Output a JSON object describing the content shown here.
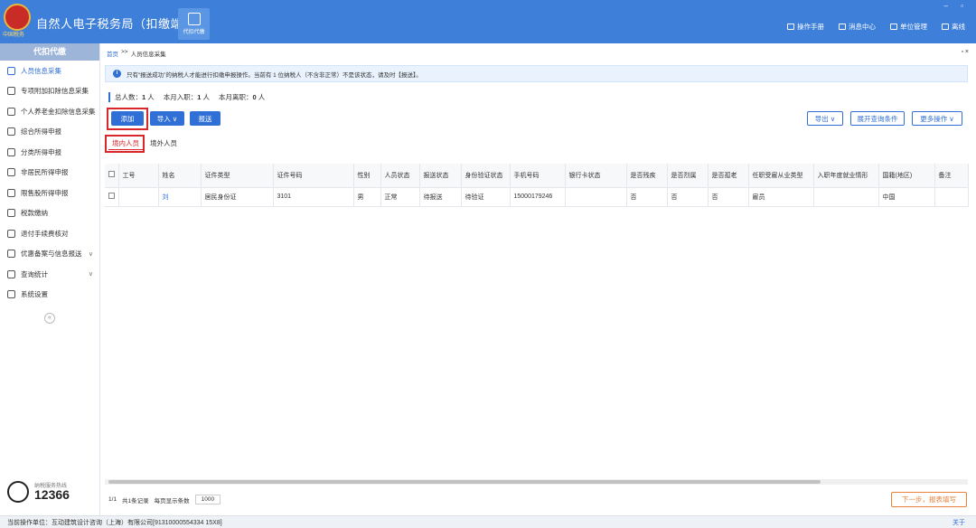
{
  "app": {
    "title": "自然人电子税务局（扣缴端）",
    "emblem_text": "中国税务"
  },
  "top_tab": {
    "label": "代扣代缴"
  },
  "top_actions": [
    "操作手册",
    "消息中心",
    "单位管理",
    "离线"
  ],
  "window_controls": "– ▫",
  "sidebar": {
    "header": "代扣代缴",
    "items": [
      {
        "label": "人员信息采集",
        "active": true
      },
      {
        "label": "专项附加扣除信息采集"
      },
      {
        "label": "个人养老金扣除信息采集"
      },
      {
        "label": "综合所得申报"
      },
      {
        "label": "分类所得申报"
      },
      {
        "label": "非居民所得申报"
      },
      {
        "label": "限售股所得申报"
      },
      {
        "label": "税款缴纳"
      },
      {
        "label": "退付手续费核对"
      },
      {
        "label": "优惠备案与信息报送",
        "chevron": "∨"
      },
      {
        "label": "查询统计",
        "chevron": "∨"
      },
      {
        "label": "系统设置"
      }
    ],
    "collapse": "«",
    "hotline_label": "纳税服务热线",
    "hotline_number": "12366"
  },
  "breadcrumb": {
    "home": "首页",
    "sep": ">>",
    "current": "人员信息采集",
    "close": "▫ ×"
  },
  "notice": {
    "icon": "i",
    "text": "只有“报送成功”的纳税人才能进行扣缴申报操作。当前有 1 位纳税人（不含非正常）不是该状态，请及时【报送】。"
  },
  "stats": {
    "total_label": "总人数：",
    "total": "1",
    "join_label": "本月入职：",
    "join": "1",
    "leave_label": "本月离职：",
    "leave": "0",
    "unit": "人"
  },
  "toolbar": {
    "add": "添加",
    "import": "导入 ∨",
    "submit": "报送",
    "export": "导出 ∨",
    "expand_query": "展开查询条件",
    "more": "更多操作 ∨"
  },
  "tabs": {
    "domestic": "境内人员",
    "overseas": "境外人员"
  },
  "table": {
    "columns": [
      "",
      "工号",
      "姓名",
      "证件类型",
      "证件号码",
      "性别",
      "人员状态",
      "报送状态",
      "身份验证状态",
      "手机号码",
      "银行卡状态",
      "是否残疾",
      "是否烈属",
      "是否孤老",
      "任职受雇从业类型",
      "入职年度就业情形",
      "国籍(地区)",
      "备注"
    ],
    "rows": [
      [
        "",
        "",
        "刘",
        "居民身份证",
        "3101",
        "男",
        "正常",
        "待报送",
        "待验证",
        "15000179246",
        "",
        "否",
        "否",
        "否",
        "雇员",
        "",
        "中国",
        ""
      ]
    ]
  },
  "pager": {
    "page": "1/1",
    "total": "共1条记录",
    "per_page_label": "每页显示条数",
    "per_page": "1000"
  },
  "next_button": "下一步，报表填写",
  "status": {
    "unit": "当前操作单位：互动建筑设计咨询（上海）有限公司[91310000554334 15X8]",
    "about": "关于"
  }
}
